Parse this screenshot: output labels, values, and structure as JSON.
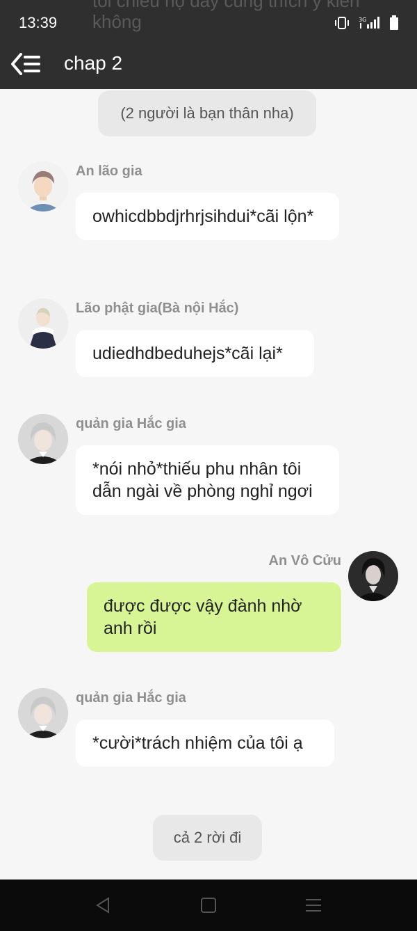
{
  "status": {
    "time": "13:39"
  },
  "background_text": "tối chiều họ đấy cũng thích ý kiến không",
  "header": {
    "title": "chap 2"
  },
  "system_messages": [
    "(2 người là bạn thân nha)",
    "cả 2 rời đi"
  ],
  "messages": [
    {
      "sender": "An lão gia",
      "text": "owhicdbbdjrhrjsihdui*cãi lộn*"
    },
    {
      "sender": "Lão phật gia(Bà nội Hắc)",
      "text": "udiedhdbeduhejs*cãi lại*"
    },
    {
      "sender": "quản gia Hắc gia",
      "text": "*nói nhỏ*thiếu phu nhân tôi dẫn ngài về phòng nghỉ ngơi"
    },
    {
      "sender": "An Vô Cửu",
      "text": "được được vậy đành nhờ anh rồi"
    },
    {
      "sender": "quản gia Hắc gia",
      "text": "*cười*trách nhiệm của tôi ạ"
    }
  ],
  "icons": {
    "back": "back-menu-icon",
    "vibrate": "vibrate-icon",
    "signal": "signal-3g-icon",
    "battery": "battery-icon",
    "nav_back": "nav-back-icon",
    "nav_home": "nav-home-icon",
    "nav_menu": "nav-menu-icon"
  },
  "colors": {
    "header_bg": "#2f2f2f",
    "chat_bg": "#f6f6f6",
    "own_bubble": "#d8f596",
    "other_bubble": "#ffffff",
    "system_bubble": "#e8e8e8"
  }
}
